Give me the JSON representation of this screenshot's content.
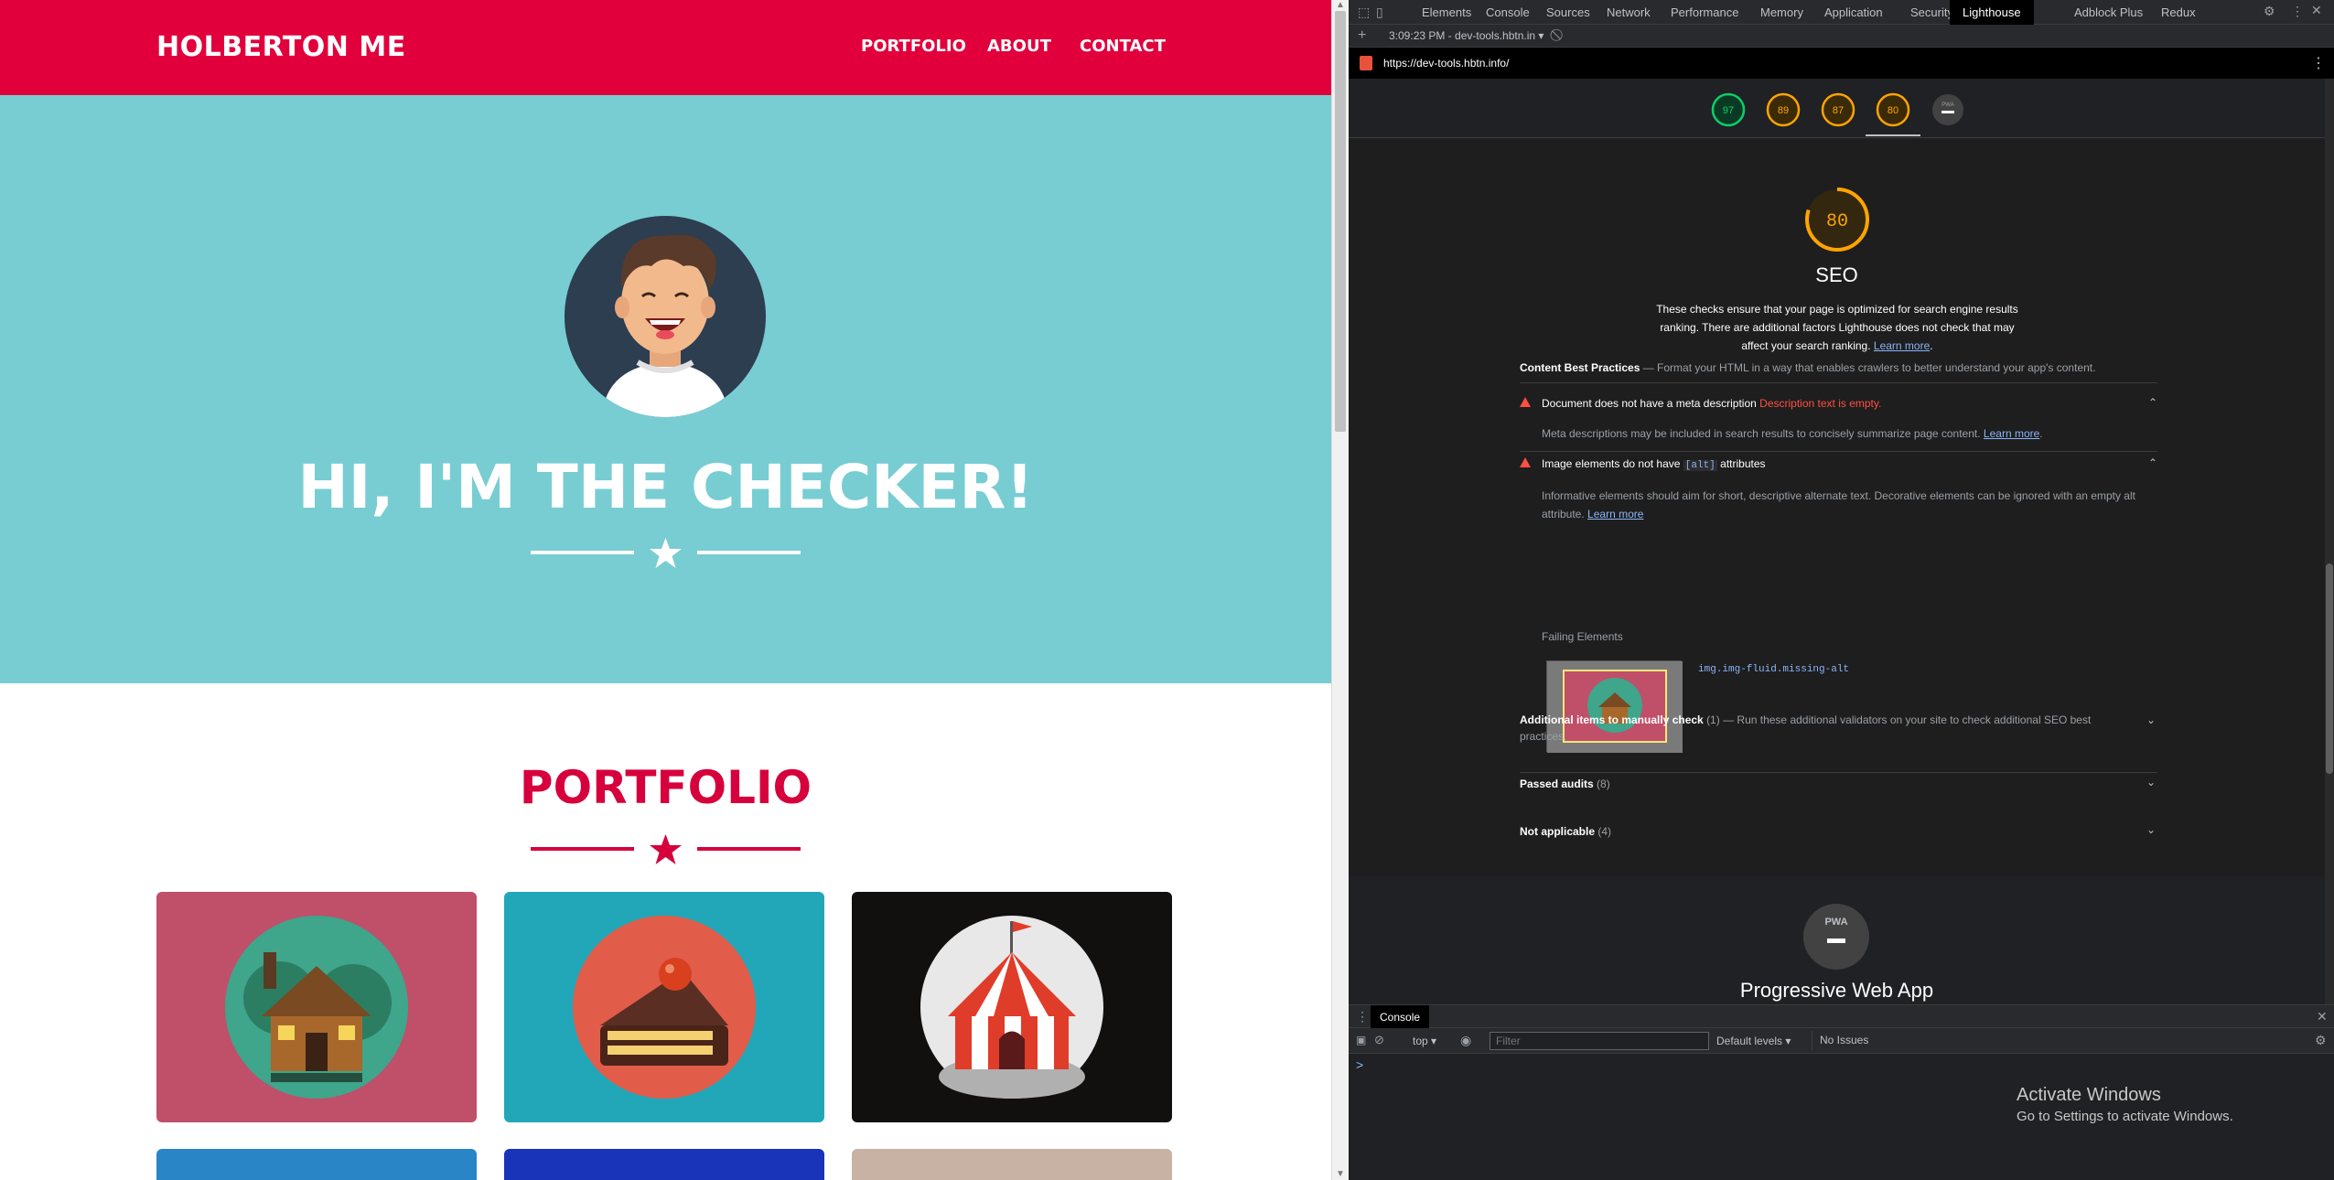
{
  "site": {
    "brand": "HOLBERTON ME",
    "nav": [
      "PORTFOLIO",
      "ABOUT",
      "CONTACT"
    ],
    "hero_title": "HI, I'M THE CHECKER!",
    "portfolio_title": "PORTFOLIO",
    "colors": {
      "nav": "#e1003c",
      "hero": "#78cdd2",
      "accent": "#d6003c"
    },
    "cards": [
      {
        "name": "cabin",
        "bg": "#c04f69"
      },
      {
        "name": "cake",
        "bg": "#22a7b9"
      },
      {
        "name": "circus",
        "bg": "#120f0f"
      },
      {
        "name": "card-4",
        "bg": "#2a85c6"
      },
      {
        "name": "card-5",
        "bg": "#1934b8"
      },
      {
        "name": "card-6",
        "bg": "#c8b2a3"
      }
    ]
  },
  "devtools": {
    "tabs": [
      "Elements",
      "Console",
      "Sources",
      "Network",
      "Performance",
      "Memory",
      "Application",
      "Security",
      "Lighthouse",
      "Adblock Plus",
      "Redux"
    ],
    "active_tab": "Lighthouse",
    "report_selector": "3:09:23 PM - dev-tools.hbtn.in",
    "url": "https://dev-tools.hbtn.info/",
    "scores": [
      {
        "value": "97",
        "color": "#0cce6b"
      },
      {
        "value": "89",
        "color": "#ffa400"
      },
      {
        "value": "87",
        "color": "#ffa400"
      },
      {
        "value": "80",
        "color": "#ffa400"
      },
      {
        "value": "PWA",
        "color": "#9aa0a6"
      }
    ],
    "seo": {
      "score": "80",
      "title": "SEO",
      "desc_1": "These checks ensure that your page is optimized for search engine results",
      "desc_2": "ranking. There are additional factors Lighthouse does not check that may",
      "desc_3": "affect your search ranking.",
      "learn_more": "Learn more",
      "group_title": "Content Best Practices",
      "group_desc": " — Format your HTML in a way that enables crawlers to better understand your app's content.",
      "audit1_title": "Document does not have a meta description",
      "audit1_error": "Description text is empty.",
      "audit1_desc": "Meta descriptions may be included in search results to concisely summarize page content.",
      "audit2_title_a": "Image elements do not have",
      "audit2_code": "[alt]",
      "audit2_title_b": "attributes",
      "audit2_desc_1": "Informative elements should aim for short, descriptive alternate text. Decorative elements can be ignored with an empty alt",
      "audit2_desc_2": "attribute.",
      "failing_label": "Failing Elements",
      "failing_selector": "img.img-fluid.missing-alt",
      "manual_title": "Additional items to manually check",
      "manual_count": "(1)",
      "manual_desc_1": " — Run these additional validators on your site to check additional SEO best",
      "manual_desc_2": "practices.",
      "passed_title": "Passed audits",
      "passed_count": "(8)",
      "na_title": "Not applicable",
      "na_count": "(4)"
    },
    "pwa_title": "Progressive Web App",
    "pwa_badge": "PWA",
    "console": {
      "tab": "Console",
      "context": "top",
      "filter_placeholder": "Filter",
      "levels": "Default levels",
      "issues": "No Issues",
      "prompt": ">"
    }
  },
  "windows": {
    "activate_title": "Activate Windows",
    "activate_sub": "Go to Settings to activate Windows."
  }
}
